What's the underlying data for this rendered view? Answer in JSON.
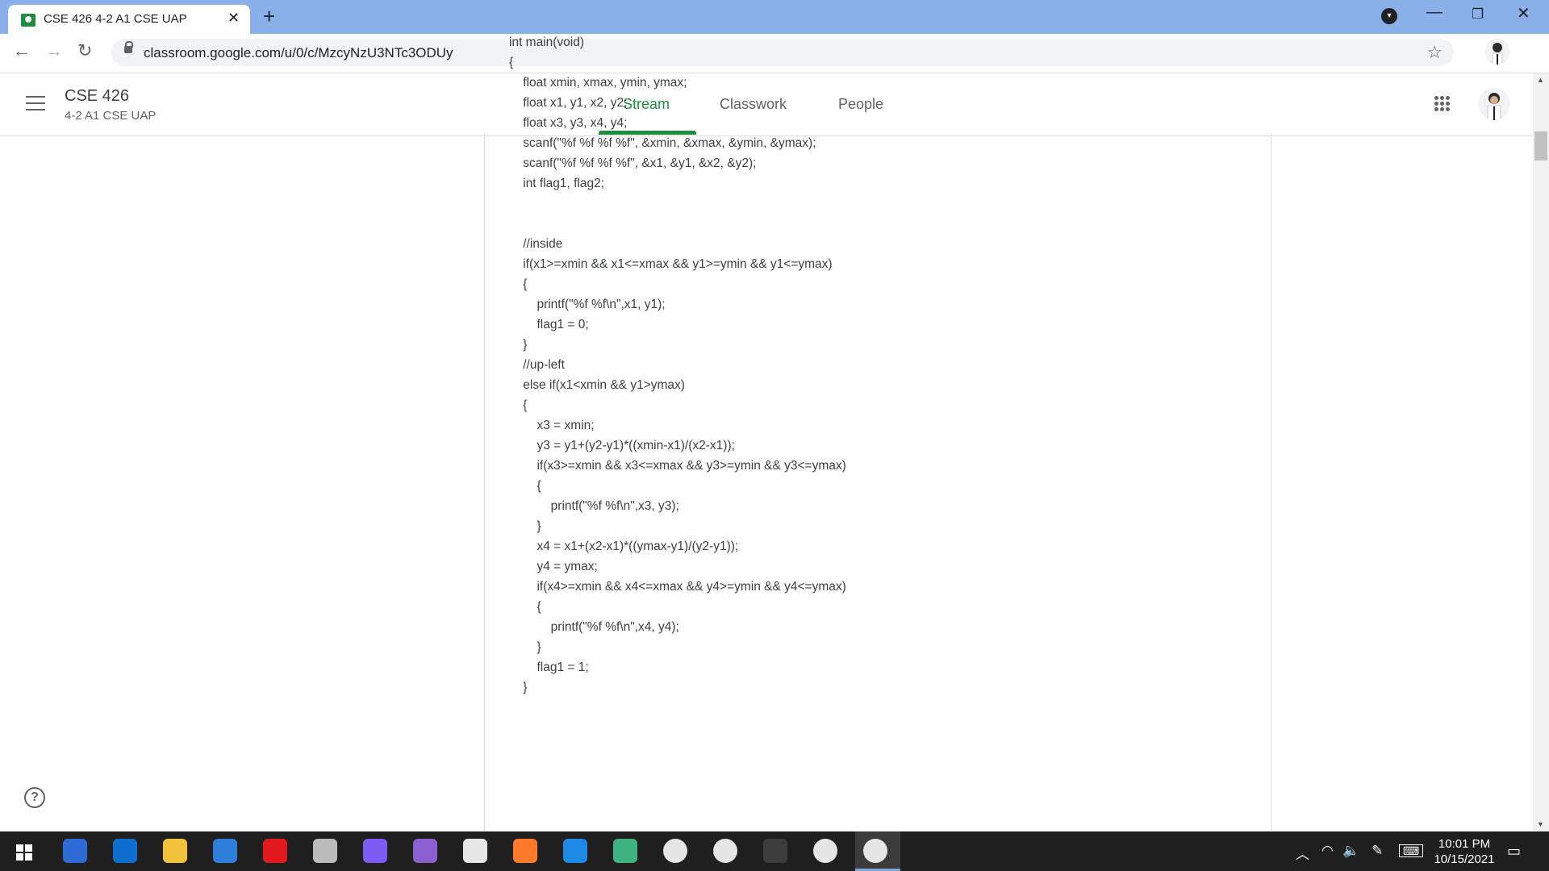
{
  "browser": {
    "tab_title": "CSE 426 4-2 A1 CSE UAP",
    "tab_close": "✕",
    "new_tab": "+",
    "url": "classroom.google.com/u/0/c/MzcyNzU3NTc3ODUy",
    "window": {
      "minimize": "—",
      "maximize": "❐",
      "close": "✕"
    }
  },
  "header": {
    "class_name": "CSE 426",
    "class_section": "4-2 A1 CSE UAP",
    "tabs": [
      {
        "label": "Stream",
        "active": true
      },
      {
        "label": "Classwork",
        "active": false
      },
      {
        "label": "People",
        "active": false
      }
    ],
    "accent_color": "#1e8e3e"
  },
  "code_lines": [
    "int main(void)",
    "{",
    "    float xmin, xmax, ymin, ymax;",
    "    float x1, y1, x2, y2;",
    "    float x3, y3, x4, y4;",
    "    scanf(\"%f %f %f %f\", &xmin, &xmax, &ymin, &ymax);",
    "    scanf(\"%f %f %f %f\", &x1, &y1, &x2, &y2);",
    "    int flag1, flag2;",
    "",
    "",
    "    //inside",
    "    if(x1>=xmin && x1<=xmax && y1>=ymin && y1<=ymax)",
    "    {",
    "        printf(\"%f %f\\n\",x1, y1);",
    "        flag1 = 0;",
    "    }",
    "    //up-left",
    "    else if(x1<xmin && y1>ymax)",
    "    {",
    "        x3 = xmin;",
    "        y3 = y1+(y2-y1)*((xmin-x1)/(x2-x1));",
    "        if(x3>=xmin && x3<=xmax && y3>=ymin && y3<=ymax)",
    "        {",
    "            printf(\"%f %f\\n\",x3, y3);",
    "        }",
    "        x4 = x1+(x2-x1)*((ymax-y1)/(y2-y1));",
    "        y4 = ymax;",
    "        if(x4>=xmin && x4<=xmax && y4>=ymin && y4<=ymax)",
    "        {",
    "            printf(\"%f %f\\n\",x4, y4);",
    "        }",
    "        flag1 = 1;",
    "    }"
  ],
  "help_label": "?",
  "taskbar": {
    "time": "10:01 PM",
    "date": "10/15/2021",
    "apps": [
      {
        "name": "qb",
        "color": "#2f6bd6"
      },
      {
        "name": "edge",
        "color": "#0f6fd1"
      },
      {
        "name": "file-explorer",
        "color": "#f2c23c"
      },
      {
        "name": "mail",
        "color": "#2d7fd9"
      },
      {
        "name": "opera",
        "color": "#e2191e"
      },
      {
        "name": "inkscape",
        "color": "#bbbbbb"
      },
      {
        "name": "messenger",
        "color": "#7d5cf5"
      },
      {
        "name": "github",
        "color": "#8b5fcf"
      },
      {
        "name": "paint",
        "color": "#e7e7e7"
      },
      {
        "name": "firefox",
        "color": "#ff7b29"
      },
      {
        "name": "vscode",
        "color": "#1e88e5"
      },
      {
        "name": "photos",
        "color": "#3fb37f"
      },
      {
        "name": "chrome",
        "color": "#e5e5e5"
      },
      {
        "name": "chrome",
        "color": "#e5e5e5"
      },
      {
        "name": "terminal",
        "color": "#3c3c3c"
      },
      {
        "name": "chrome-ek",
        "color": "#e5e5e5"
      },
      {
        "name": "chrome-active",
        "color": "#e5e5e5"
      }
    ]
  }
}
